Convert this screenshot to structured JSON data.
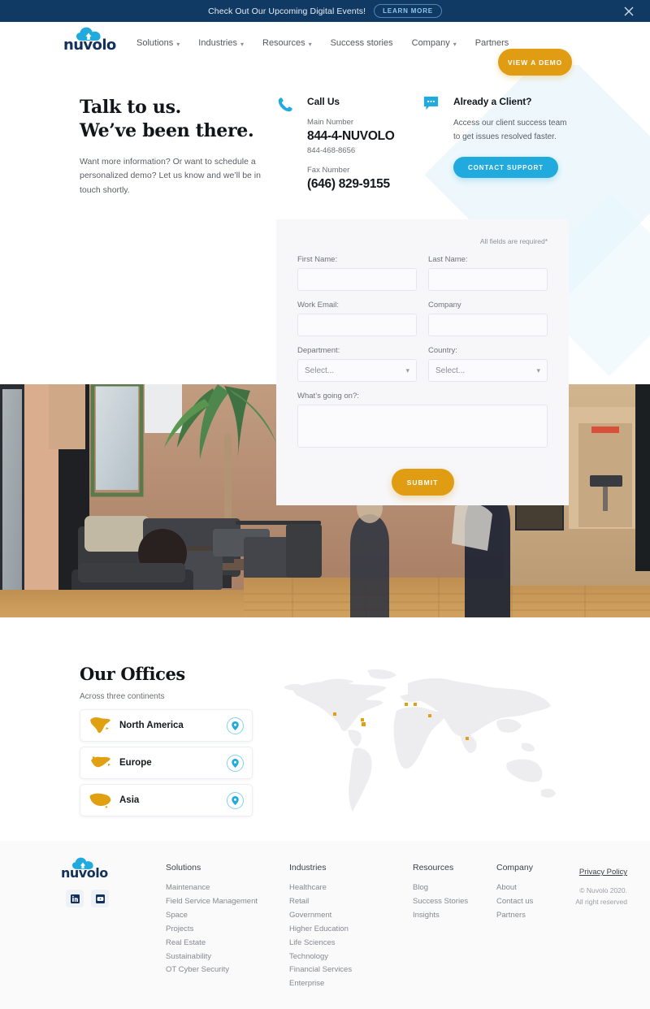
{
  "announcement": {
    "text": "Check Out Our Upcoming Digital Events!",
    "cta": "LEARN MORE",
    "close_icon": "close-icon"
  },
  "header": {
    "logo_word": "nuvolo",
    "nav": [
      {
        "label": "Solutions",
        "has_caret": true
      },
      {
        "label": "Industries",
        "has_caret": true
      },
      {
        "label": "Resources",
        "has_caret": true
      },
      {
        "label": "Success stories",
        "has_caret": false
      },
      {
        "label": "Company",
        "has_caret": true
      },
      {
        "label": "Partners",
        "has_caret": false
      }
    ],
    "demo_button": "VIEW A DEMO"
  },
  "hero": {
    "title_line1": "Talk to us.",
    "title_line2": "We’ve been there.",
    "paragraph": "Want more information? Or want to schedule a personalized demo? Let us know and we’ll be in touch shortly."
  },
  "call_us": {
    "icon": "phone-icon",
    "title": "Call Us",
    "main_label": "Main Number",
    "main_number": "844-4-NUVOLO",
    "main_number_alt": "844-468-8656",
    "fax_label": "Fax Number",
    "fax_number": "(646) 829-9155"
  },
  "client": {
    "icon": "chat-bubble-icon",
    "title": "Already a Client?",
    "text": "Access our client success team to get issues resolved faster.",
    "button": "CONTACT SUPPORT"
  },
  "form": {
    "required_note": "All fields are required*",
    "first_name_label": "First Name:",
    "first_name_value": "",
    "last_name_label": "Last Name:",
    "last_name_value": "",
    "work_email_label": "Work Email:",
    "work_email_value": "",
    "company_label": "Company",
    "company_value": "",
    "department_label": "Department:",
    "department_value": "Select...",
    "country_label": "Country:",
    "country_value": "Select...",
    "message_label": "What’s going on?:",
    "message_value": "",
    "submit": "SUBMIT"
  },
  "offices": {
    "title": "Our Offices",
    "subtitle": "Across three continents",
    "items": [
      {
        "name": "North America",
        "icon": "north-america-icon",
        "pin": "map-pin-icon"
      },
      {
        "name": "Europe",
        "icon": "europe-icon",
        "pin": "map-pin-icon"
      },
      {
        "name": "Asia",
        "icon": "asia-icon",
        "pin": "map-pin-icon"
      }
    ]
  },
  "footer": {
    "logo_word": "nuvolo",
    "social": [
      {
        "name": "linkedin-icon"
      },
      {
        "name": "youtube-icon"
      }
    ],
    "columns": [
      {
        "title": "Solutions",
        "links": [
          "Maintenance",
          "Field Service Management",
          "Space",
          "Projects",
          "Real Estate",
          "Sustainability",
          "OT Cyber Security"
        ]
      },
      {
        "title": "Industries",
        "links": [
          "Healthcare",
          "Retail",
          "Government",
          "Higher Education",
          "Life Sciences",
          "Technology",
          "Financial Services",
          "Enterprise"
        ]
      },
      {
        "title": "Resources",
        "links": [
          "Blog",
          "Success Stories",
          "Insights"
        ]
      },
      {
        "title": "Company",
        "links": [
          "About",
          "Contact us",
          "Partners"
        ]
      }
    ],
    "privacy": "Privacy Policy",
    "copyright_line1": "© Nuvolo 2020.",
    "copyright_line2": "All right reserved"
  },
  "colors": {
    "announce_bg": "#103a63",
    "brand_navy": "#14315c",
    "brand_cyan": "#20aade",
    "accent_orange": "#e09c12",
    "map_land": "#ededf0",
    "map_dot": "#e0a011"
  }
}
